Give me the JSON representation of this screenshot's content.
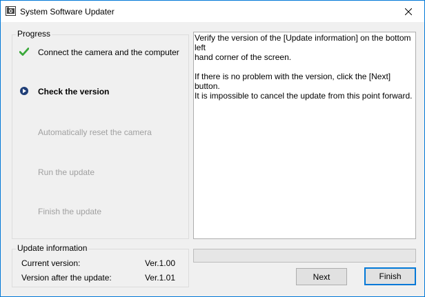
{
  "window": {
    "title": "System Software Updater"
  },
  "progress": {
    "label": "Progress",
    "steps": [
      {
        "label": "Connect the camera and the computer",
        "state": "done"
      },
      {
        "label": "Check the version",
        "state": "current"
      },
      {
        "label": "Automatically reset the camera",
        "state": "pending"
      },
      {
        "label": "Run the update",
        "state": "pending"
      },
      {
        "label": "Finish the update",
        "state": "pending"
      }
    ]
  },
  "update_info": {
    "label": "Update information",
    "current_version_label": "Current version:",
    "current_version_value": "Ver.1.00",
    "after_version_label": "Version after the update:",
    "after_version_value": "Ver.1.01"
  },
  "message": {
    "line1": "Verify the version of the [Update information] on the bottom left",
    "line2": "hand corner of the screen.",
    "line3": "If there is no problem with the version, click the [Next] button.",
    "line4": "It is impossible to cancel the update from this point forward."
  },
  "progress_bar": {
    "fraction": 0
  },
  "buttons": {
    "next_label": "Next",
    "finish_label": "Finish"
  },
  "colors": {
    "accent": "#0078d7",
    "done_check": "#3aa83a",
    "current_step_icon": "#1f3e77",
    "pending_text": "#a0a0a0"
  }
}
